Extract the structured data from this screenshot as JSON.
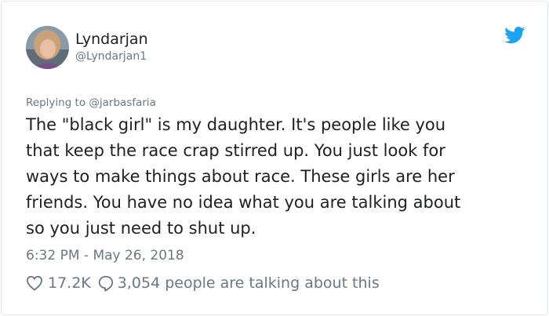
{
  "tweet": {
    "display_name": "Lyndarjan",
    "handle": "@Lyndarjan1",
    "reply_prefix": "Replying to ",
    "reply_to": "@jarbasfaria",
    "text": "The \"black girl\"  is my daughter.  It's people like you\nthat keep  the race crap stirred up.  You just look for\nways to make things about race.  These girls are her\nfriends. You have no idea what you are talking about\nso you just need to shut up.",
    "timestamp": "6:32 PM - May 26, 2018",
    "likes": "17.2K",
    "talking": "3,054 people are talking about this"
  },
  "colors": {
    "brand": "#1da1f2",
    "text": "#1c2022",
    "muted": "#697882",
    "border": "#e1e8ed"
  },
  "icons": {
    "logo": "twitter-bird-icon",
    "like": "heart-icon",
    "reply": "speech-bubble-icon"
  }
}
